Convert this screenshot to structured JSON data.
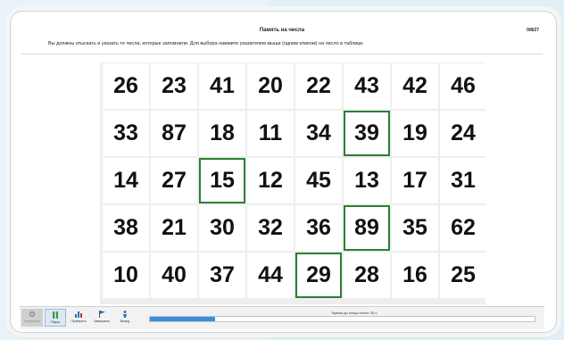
{
  "window": {
    "title": "Память на числа",
    "counter": "0/8/27"
  },
  "instructions": "Вы должны отыскать и указать те числа, которые запомнили. Для выбора нажмите указателем мыши (одним кликом) на число в таблице.",
  "grid": {
    "rows": [
      [
        "26",
        "23",
        "41",
        "20",
        "22",
        "43",
        "42",
        "46"
      ],
      [
        "33",
        "87",
        "18",
        "11",
        "34",
        "39",
        "19",
        "24"
      ],
      [
        "14",
        "27",
        "15",
        "12",
        "45",
        "13",
        "17",
        "31"
      ],
      [
        "38",
        "21",
        "30",
        "32",
        "36",
        "89",
        "35",
        "62"
      ],
      [
        "10",
        "40",
        "37",
        "44",
        "29",
        "28",
        "16",
        "25"
      ]
    ],
    "selected": [
      "39",
      "15",
      "89",
      "29"
    ],
    "selected_color": "#2e7d32"
  },
  "toolbar": {
    "buttons": [
      {
        "label": "Настройки",
        "icon": "gear-icon",
        "state": "disabled"
      },
      {
        "label": "Пауза",
        "icon": "pause-icon",
        "state": "active"
      },
      {
        "label": "Проверить",
        "icon": "chart-icon",
        "state": "normal"
      },
      {
        "label": "Завершить",
        "icon": "flag-icon",
        "state": "normal"
      },
      {
        "label": "Выход",
        "icon": "exit-icon",
        "state": "normal"
      }
    ],
    "timer_label": "Время до конца теста: 30 с",
    "progress": 0.17,
    "progress_color": "#3c8fd6"
  }
}
